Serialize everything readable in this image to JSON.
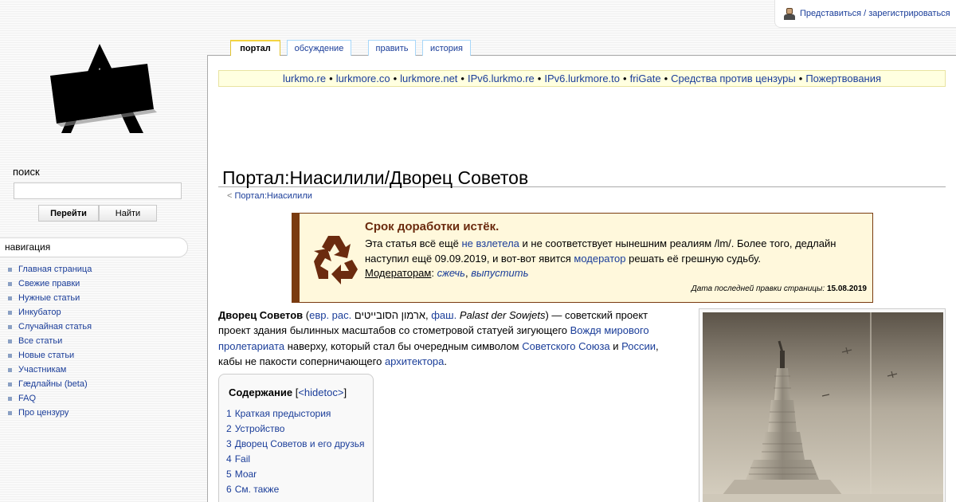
{
  "user": {
    "login_label": "Представиться / зарегистрироваться"
  },
  "search": {
    "label": "поиск",
    "value": "",
    "go_button": "Перейти",
    "find_button": "Найти"
  },
  "navigation": {
    "header": "навигация",
    "items": [
      "Главная страница",
      "Свежие правки",
      "Нужные статьи",
      "Инкубатор",
      "Случайная статья",
      "Все статьи",
      "Новые статьи",
      "Участникам",
      "Гæдлайны (beta)",
      "FAQ",
      "Про цензуру"
    ]
  },
  "tabs": [
    "портал",
    "обсуждение",
    "править",
    "история"
  ],
  "sitenotice": [
    "lurkmo.re",
    "lurkmore.co",
    "lurkmore.net",
    "IPv6.lurkmo.re",
    "IPv6.lurkmore.to",
    "friGate",
    "Средства против цензуры",
    "Пожертвования"
  ],
  "sitenotice_separator": "•",
  "page": {
    "title": "Портал:Ниасилили/Дворец Советов",
    "subpages_prefix": "<",
    "subpages_link": "Портал:Ниасилили"
  },
  "notice": {
    "title": "Срок доработки истёк.",
    "line1_a": "Эта статья всё ещё ",
    "line1_link": "не взлетела",
    "line1_b": " и не соответствует нынешним реалиям /lm/. Более того, дедлайн",
    "line2_a": "наступил ещё 09.09.2019, и вот-вот явится ",
    "line2_link": "модератор",
    "line2_b": " решать её грешную судьбу.",
    "mods_label": "Модераторам",
    "mods_burn": "сжечь",
    "mods_release": "выпустить",
    "date_label": "Дата последней правки страницы:",
    "date_value": "15.08.2019"
  },
  "article": {
    "bold": "Дворец Советов",
    "paren_open": " (",
    "lang1": "евр. рас.",
    "hebrew": " ארמון הסובייטים",
    "comma": ", ",
    "lang2": "фаш.",
    "german": " Palast der Sowjets",
    "rest1": ") — советский проект",
    "rest2": "проект здания былинных масштабов со стометровой статуей зигующего ",
    "link_leader": "Вождя мирового пролетариата",
    "rest3": " наверху, который стал бы очередным символом ",
    "link_ussr": "Советского Союза",
    "and": " и ",
    "link_russia": "России",
    "rest4": ",",
    "rest5": "кабы не пакости соперничающего ",
    "link_arch": "архитектора",
    "rest6": "."
  },
  "toc": {
    "title": "Содержание",
    "hide_open": " [",
    "hide_label": "<hidetoc>",
    "hide_close": "]",
    "items": [
      {
        "num": "1",
        "label": "Краткая предыстория"
      },
      {
        "num": "2",
        "label": "Устройство"
      },
      {
        "num": "3",
        "label": "Дворец Советов и его друзья"
      },
      {
        "num": "4",
        "label": "Fail"
      },
      {
        "num": "5",
        "label": "Моar"
      },
      {
        "num": "6",
        "label": "См. также"
      }
    ]
  },
  "colors": {
    "link": "#1a3d99",
    "notice_border": "#7a3b10",
    "notice_bg": "#fff8dc",
    "sitenotice_bg": "#ffffe0"
  }
}
